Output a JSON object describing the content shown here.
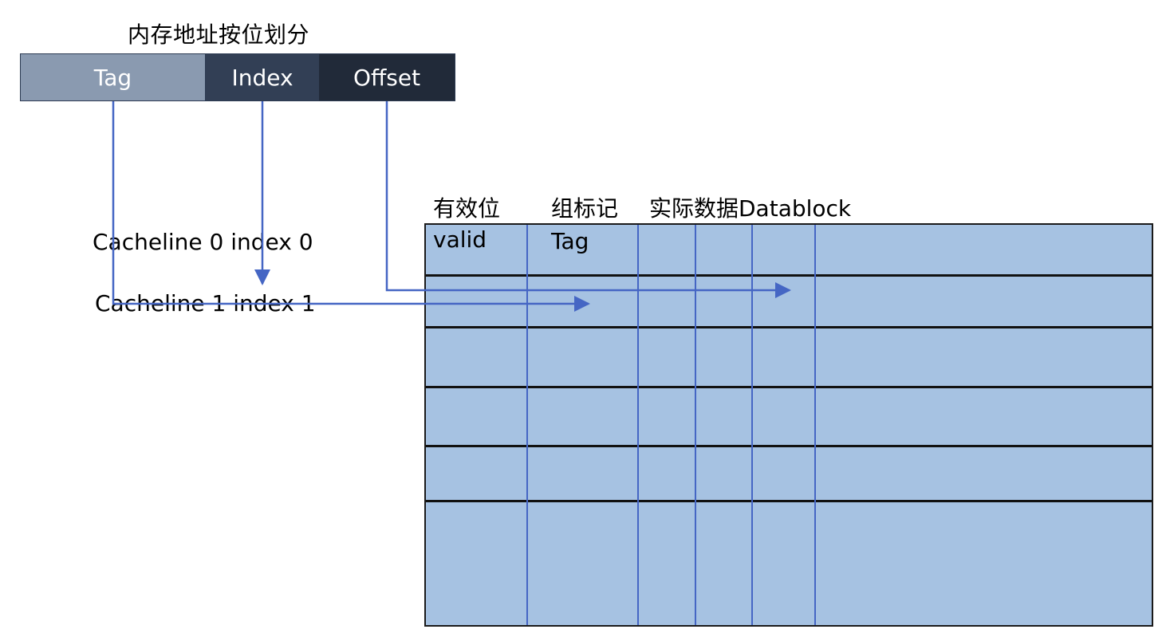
{
  "title": "内存地址按位划分",
  "address_fields": {
    "tag": "Tag",
    "index": "Index",
    "offset": "Offset"
  },
  "cachelines": [
    "Cacheline 0 index 0",
    "Cacheline 1 index 1"
  ],
  "table_headers": {
    "valid_header": "有效位",
    "tag_header": "组标记",
    "data_header": "实际数据Datablock"
  },
  "table_subheaders": {
    "valid": "valid",
    "tag": "Tag"
  },
  "colors": {
    "tag_segment": "#8a9ab0",
    "index_segment": "#323f55",
    "offset_segment": "#212a39",
    "table_fill": "#a6c2e2",
    "arrow_color": "#4566c4"
  }
}
